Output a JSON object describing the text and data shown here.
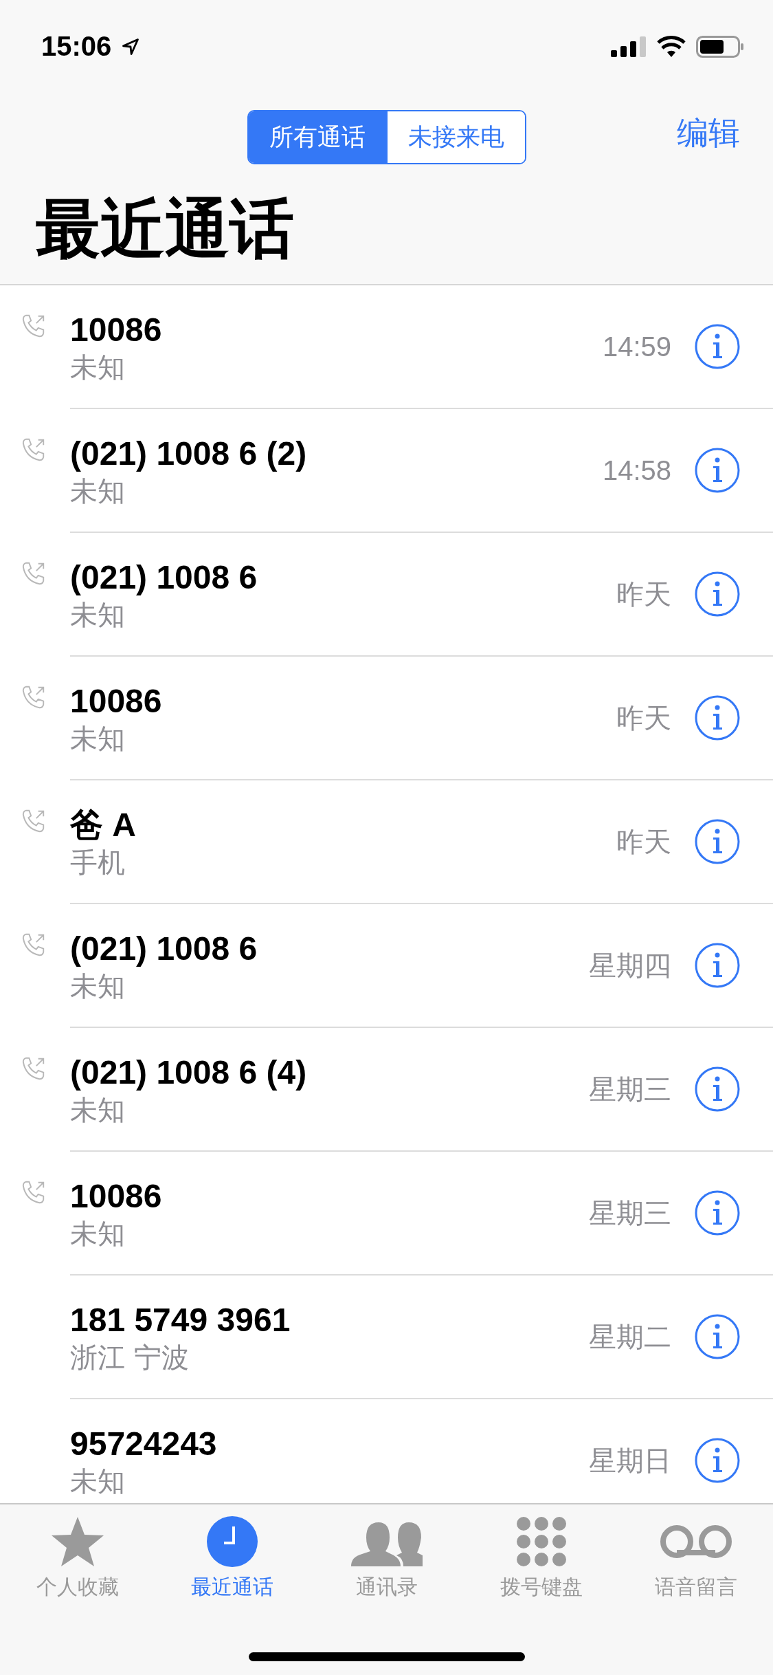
{
  "status_bar": {
    "time": "15:06",
    "location": true
  },
  "segments": [
    {
      "label": "所有通话",
      "selected": true
    },
    {
      "label": "未接来电",
      "selected": false
    }
  ],
  "edit_button": "编辑",
  "title": "最近通话",
  "calls": [
    {
      "number": "10086",
      "detail": "未知",
      "when": "14:59",
      "outgoing": true
    },
    {
      "number": "(021) 1008 6 (2)",
      "detail": "未知",
      "when": "14:58",
      "outgoing": true
    },
    {
      "number": "(021) 1008 6",
      "detail": "未知",
      "when": "昨天",
      "outgoing": true
    },
    {
      "number": "10086",
      "detail": "未知",
      "when": "昨天",
      "outgoing": true
    },
    {
      "number": "爸 A",
      "detail": "手机",
      "when": "昨天",
      "outgoing": true
    },
    {
      "number": "(021) 1008 6",
      "detail": "未知",
      "when": "星期四",
      "outgoing": true
    },
    {
      "number": "(021) 1008 6 (4)",
      "detail": "未知",
      "when": "星期三",
      "outgoing": true
    },
    {
      "number": "10086",
      "detail": "未知",
      "when": "星期三",
      "outgoing": true
    },
    {
      "number": "181 5749 3961",
      "detail": "浙江 宁波",
      "when": "星期二",
      "outgoing": false
    },
    {
      "number": "95724243",
      "detail": "未知",
      "when": "星期日",
      "outgoing": false
    }
  ],
  "tab_bar": [
    {
      "kind": "star",
      "label": "个人收藏",
      "selected": false
    },
    {
      "kind": "clock",
      "label": "最近通话",
      "selected": true
    },
    {
      "kind": "people",
      "label": "通讯录",
      "selected": false
    },
    {
      "kind": "keypad",
      "label": "拨号键盘",
      "selected": false
    },
    {
      "kind": "voicemail",
      "label": "语音留言",
      "selected": false
    }
  ]
}
